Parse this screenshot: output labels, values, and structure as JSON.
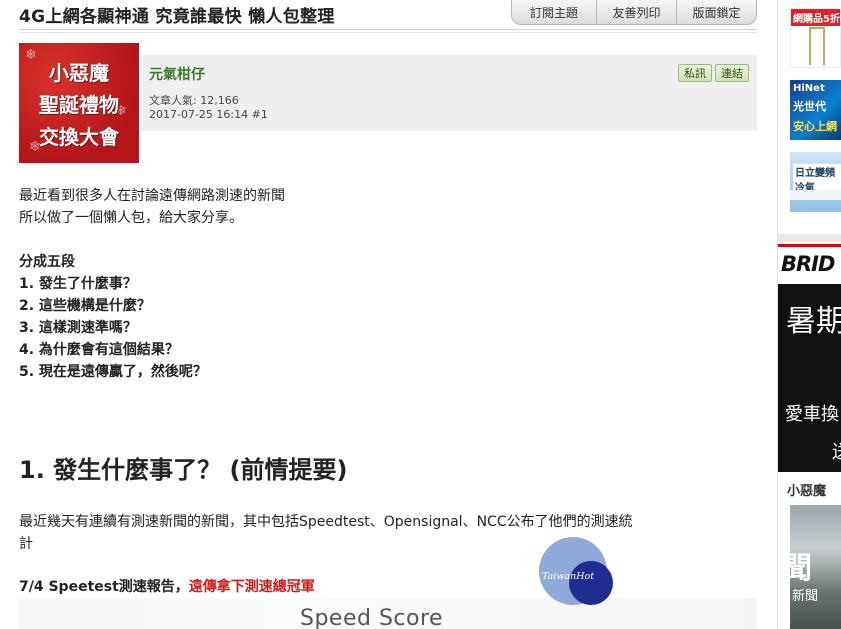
{
  "header": {
    "title": "4G上網各顯神通 究竟誰最快 懶人包整理",
    "buttons": [
      "訂閱主題",
      "友善列印",
      "版面鎖定"
    ]
  },
  "author": {
    "avatar_text": [
      "小惡魔",
      "聖誕禮物",
      "交換大會"
    ],
    "name": "元氣柑仔",
    "views_label": "文章人氣: 12,166",
    "posted": "2017-07-25 16:14  #1",
    "actions": [
      "私訊",
      "連結"
    ]
  },
  "content": {
    "intro": [
      "最近看到很多人在討論遠傳網路測速的新聞",
      "所以做了一個懶人包，給大家分享。"
    ],
    "outline_title": "分成五段",
    "outline": [
      "1. 發生了什麼事？",
      "2. 這些機構是什麼？",
      "3. 這樣測速準嗎？",
      "4. 為什麼會有這個結果？",
      "5. 現在是遠傳贏了，然後呢？"
    ],
    "section1_title": "1. 發生什麼事了？ (前情提要)",
    "section1_line1": "最近幾天有連續有測速新聞的新聞，其中包括Speedtest、Opensignal、NCC公布了他們的測速統",
    "section1_line2": "計",
    "report_prefix": "7/4 Speetest測速報告，",
    "report_highlight": "遠傳拿下測速總冠軍",
    "chart_caption": "Speed Score",
    "watermark": "TaiwanHot"
  },
  "sidebar": {
    "ad1_tag": "網購品5折",
    "ad2_lines": [
      "HiNet",
      "光世代",
      "安心上網"
    ],
    "ad3_text": "日立變頻冷氣",
    "brand": "BRID",
    "bigad_lines": [
      "暑期",
      "愛車換",
      "送"
    ],
    "section_title": "小惡魔",
    "news_big": "聞",
    "news_small": "新聞"
  },
  "colors": {
    "accent_green": "#3a7a2a",
    "highlight_red": "#d11a1a",
    "logo_blue": "#1e2d8f"
  }
}
